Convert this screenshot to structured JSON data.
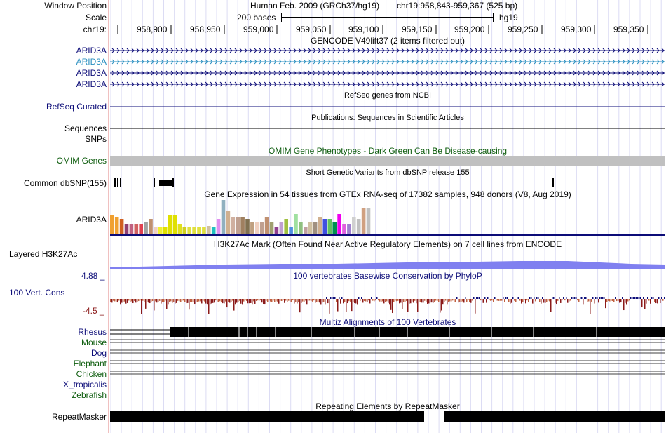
{
  "header": {
    "window_position_label": "Window Position",
    "assembly_text": "Human Feb. 2009 (GRCh37/hg19)",
    "position_text": "chr19:958,843-959,367 (525 bp)",
    "scale_label": "Scale",
    "scale_text": "200 bases",
    "scale_db": "hg19",
    "chrom_label": "chr19:",
    "ticks": [
      "958,900",
      "958,950",
      "959,000",
      "959,050",
      "959,100",
      "959,150",
      "959,200",
      "959,250",
      "959,300",
      "959,350"
    ]
  },
  "tracks": {
    "gencode": {
      "title": "GENCODE V49lift37 (2 items filtered out)",
      "items": [
        "ARID3A",
        "ARID3A",
        "ARID3A",
        "ARID3A"
      ]
    },
    "refseq": {
      "title": "RefSeq genes from NCBI",
      "label": "RefSeq Curated"
    },
    "publications": {
      "title": "Publications: Sequences in Scientific Articles",
      "label_sequences": "Sequences",
      "label_snps": "SNPs"
    },
    "omim": {
      "title": "OMIM Gene Phenotypes - Dark Green Can Be Disease-causing",
      "label": "OMIM Genes"
    },
    "dbsnp": {
      "title": "Short Genetic Variants from dbSNP release 155",
      "label": "Common dbSNP(155)"
    },
    "gtex": {
      "title": "Gene Expression in 54 tissues from GTEx RNA-seq of 17382 samples, 948 donors (V8, Aug 2019)",
      "label": "ARID3A",
      "bars": [
        0.55,
        0.5,
        0.45,
        0.3,
        0.3,
        0.3,
        0.3,
        0.35,
        0.45,
        0.2,
        0.2,
        0.2,
        0.55,
        0.55,
        0.3,
        0.2,
        0.2,
        0.2,
        0.2,
        0.2,
        0.25,
        0.2,
        0.45,
        1.0,
        0.7,
        0.5,
        0.5,
        0.5,
        0.45,
        0.35,
        0.35,
        0.35,
        0.5,
        0.35,
        0.2,
        0.35,
        0.45,
        0.2,
        0.6,
        0.35,
        0.2,
        0.35,
        0.35,
        0.5,
        0.45,
        0.45,
        0.35,
        0.6,
        0.3,
        0.3,
        0.5,
        0.45,
        0.75,
        0.75
      ],
      "colors": [
        "#f0a030",
        "#f0a030",
        "#d06020",
        "#904070",
        "#c06080",
        "#d06060",
        "#e04050",
        "#a0a0a0",
        "#c09070",
        "#f0d0c0",
        "#f0f030",
        "#e0e000",
        "#e0e000",
        "#e0e000",
        "#e0e020",
        "#d0d020",
        "#e0e040",
        "#e0e040",
        "#e0e040",
        "#e0e040",
        "#d0c0a0",
        "#20c0c0",
        "#e090f0",
        "#90b0c0",
        "#d0b090",
        "#d0b0a0",
        "#c0a090",
        "#a08060",
        "#807050",
        "#c0a080",
        "#f0d0c0",
        "#c0a090",
        "#c09070",
        "#a0a070",
        "#904090",
        "#c0a0d0",
        "#a0c040",
        "#5090e0",
        "#a0e0a0",
        "#90c080",
        "#c0a0a0",
        "#d0c0a0",
        "#a09080",
        "#d0b090",
        "#4050e0",
        "#60c060",
        "#009050",
        "#f000f0",
        "#e060e0",
        "#a080d0",
        "#d0d0d0",
        "#c0c0c0",
        "#d0a080",
        "#c0c0c0"
      ]
    },
    "h3k27ac": {
      "title": "H3K27Ac Mark (Often Found Near Active Regulatory Elements) on 7 cell lines from ENCODE",
      "label": "Layered H3K27Ac"
    },
    "phylop": {
      "title": "100 vertebrates Basewise Conservation by PhyloP",
      "label": "100 Vert. Cons",
      "max_label": "4.88 _",
      "min_label": "-4.5 _"
    },
    "multiz": {
      "title": "Multiz Alignments of 100 Vertebrates",
      "species": [
        "Rhesus",
        "Mouse",
        "Dog",
        "Elephant",
        "Chicken",
        "X_tropicalis",
        "Zebrafish"
      ]
    },
    "repeatmasker": {
      "title": "Repeating Elements by RepeatMasker",
      "label": "RepeatMasker"
    }
  },
  "colors": {
    "navy": "#0c0c78",
    "teal": "#2a8fc0",
    "green": "#0d5c0d",
    "h3k27ac": "#8080f0",
    "omim": "#c0c0c0"
  }
}
